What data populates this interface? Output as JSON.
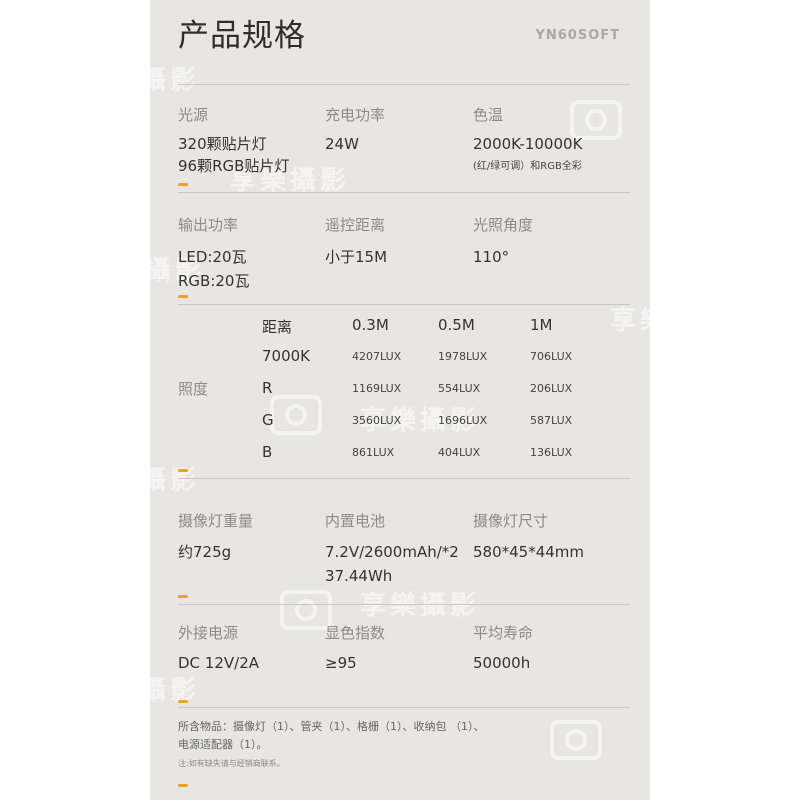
{
  "header": {
    "title": "产品规格",
    "brand": "YN60SOFT"
  },
  "specs_row1": {
    "light_source": {
      "label": "光源",
      "value_line1": "320颗贴片灯",
      "value_line2": "96颗RGB贴片灯"
    },
    "charging_power": {
      "label": "充电功率",
      "value": "24W"
    },
    "color_temp": {
      "label": "色温",
      "value": "2000K-10000K",
      "note": "(红/绿可调）和RGB全彩"
    }
  },
  "specs_row2": {
    "output_power": {
      "label": "输出功率",
      "value_line1": "LED:20瓦",
      "value_line2": "RGB:20瓦"
    },
    "remote_distance": {
      "label": "遥控距离",
      "value": "小于15M"
    },
    "beam_angle": {
      "label": "光照角度",
      "value": "110°"
    }
  },
  "illuminance": {
    "label": "照度",
    "headers": [
      "距离",
      "0.3M",
      "0.5M",
      "1M"
    ],
    "rows": [
      {
        "name": "7000K",
        "values": [
          "4207LUX",
          "1978LUX",
          "706LUX"
        ]
      },
      {
        "name": "R",
        "values": [
          "1169LUX",
          "554LUX",
          "206LUX"
        ]
      },
      {
        "name": "G",
        "values": [
          "3560LUX",
          "1696LUX",
          "587LUX"
        ]
      },
      {
        "name": "B",
        "values": [
          "861LUX",
          "404LUX",
          "136LUX"
        ]
      }
    ]
  },
  "specs_row3": {
    "weight": {
      "label": "摄像灯重量",
      "value": "约725g"
    },
    "battery": {
      "label": "内置电池",
      "value_line1": "7.2V/2600mAh/*2",
      "value_line2": "37.44Wh"
    },
    "size": {
      "label": "摄像灯尺寸",
      "value": "580*45*44mm"
    }
  },
  "specs_row4": {
    "power_supply": {
      "label": "外接电源",
      "value": "DC 12V/2A"
    },
    "cri": {
      "label": "显色指数",
      "value": "≥95"
    },
    "lifespan": {
      "label": "平均寿命",
      "value": "50000h"
    }
  },
  "footer": {
    "contents_line1": "所含物品：摄像灯（1）、管夹（1）、格栅（1）、收纳包 （1）、",
    "contents_line2": "电源适配器（1）。",
    "note": "注:如有缺失请与经销商联系。"
  },
  "watermark": {
    "text": "享樂攝影"
  },
  "colors": {
    "accent": "#f0a21b",
    "panel": "#e7e6e3",
    "label": "#8b8b8b"
  }
}
